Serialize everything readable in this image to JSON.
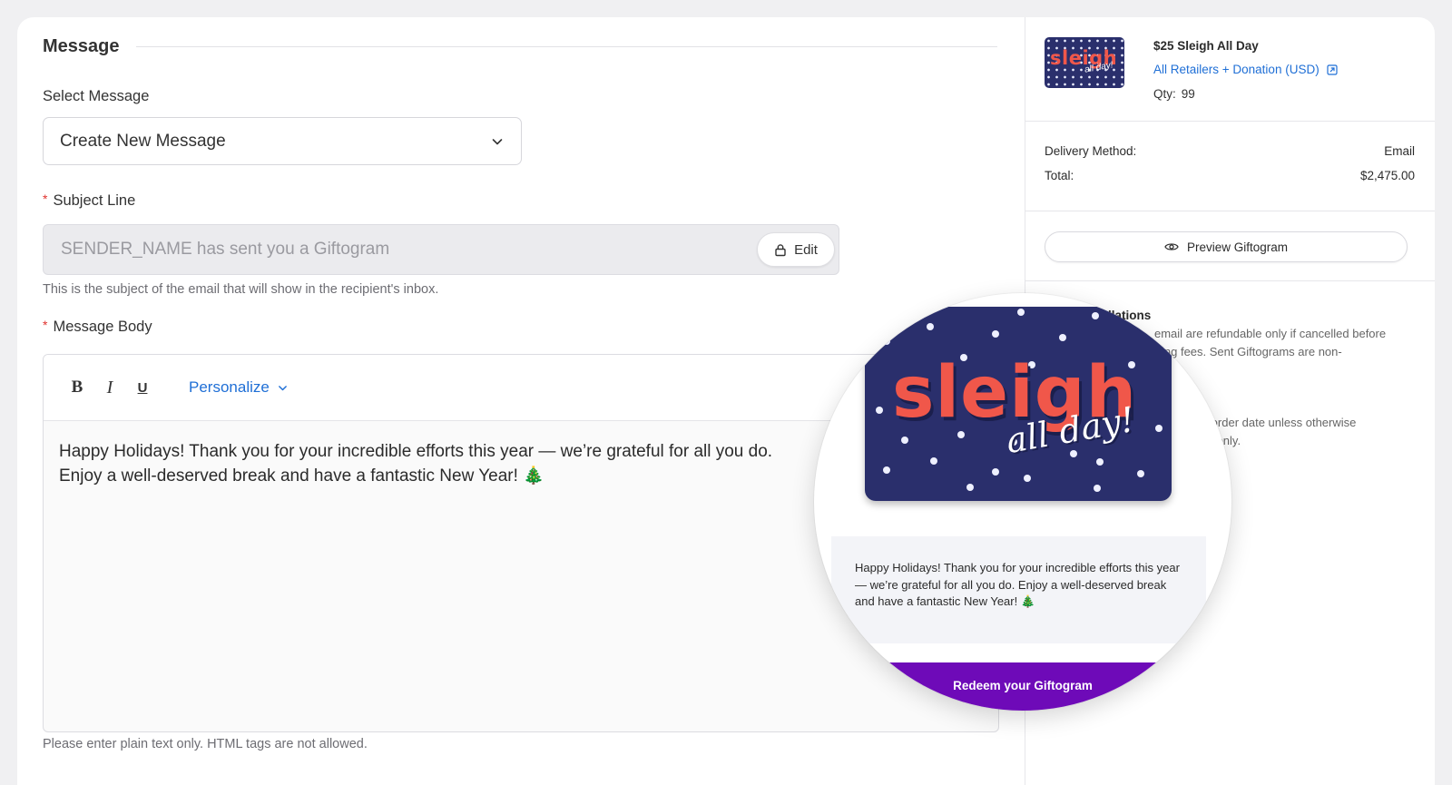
{
  "message_section": {
    "title": "Message",
    "select_label": "Select Message",
    "select_value": "Create New Message",
    "subject_label": "Subject Line",
    "subject_value": "SENDER_NAME has sent you a Giftogram",
    "edit_label": "Edit",
    "subject_helper": "This is the subject of the email that will show in the recipient's inbox.",
    "body_label": "Message Body",
    "toolbar": {
      "bold": "B",
      "italic": "I",
      "underline": "U",
      "personalize": "Personalize"
    },
    "body_line1": "Happy Holidays! Thank you for your incredible efforts this year — we’re grateful for all you do.",
    "body_line2": "Enjoy a well-deserved break and have a fantastic New Year! 🎄",
    "body_helper": "Please enter plain text only. HTML tags are not allowed."
  },
  "summary": {
    "card_art_text": "sleigh",
    "card_art_subtext": "all day!",
    "product_title": "$25 Sleigh All Day",
    "product_link": "All Retailers + Donation (USD)",
    "qty_label": "Qty:",
    "qty_value": "99",
    "delivery_label": "Delivery Method:",
    "delivery_value": "Email",
    "total_label": "Total:",
    "total_value": "$2,475.00",
    "preview_label": "Preview Giftogram",
    "policy_title_partial": "llations",
    "policy_line1": "email are refundable only if cancelled before",
    "policy_line2": "ing fees. Sent Giftograms are non-",
    "policy_line3": "om order date unless otherwise",
    "policy_line4": "use only."
  },
  "preview_magnifier": {
    "card_word": "sleigh",
    "card_sub": "all day!",
    "message": "Happy Holidays! Thank you for your incredible efforts this year — we’re grateful for all you do. Enjoy a well-deserved break and have a fantastic New Year! 🎄",
    "redeem_label": "Redeem your Giftogram"
  },
  "colors": {
    "accent_blue": "#1f6fd6",
    "required_red": "#e0322e",
    "card_navy": "#2a2f6c",
    "card_coral": "#f0574a",
    "redeem_purple": "#6e0ab8"
  },
  "icons": [
    "chevron-down-icon",
    "lock-icon",
    "external-link-icon",
    "eye-icon"
  ]
}
